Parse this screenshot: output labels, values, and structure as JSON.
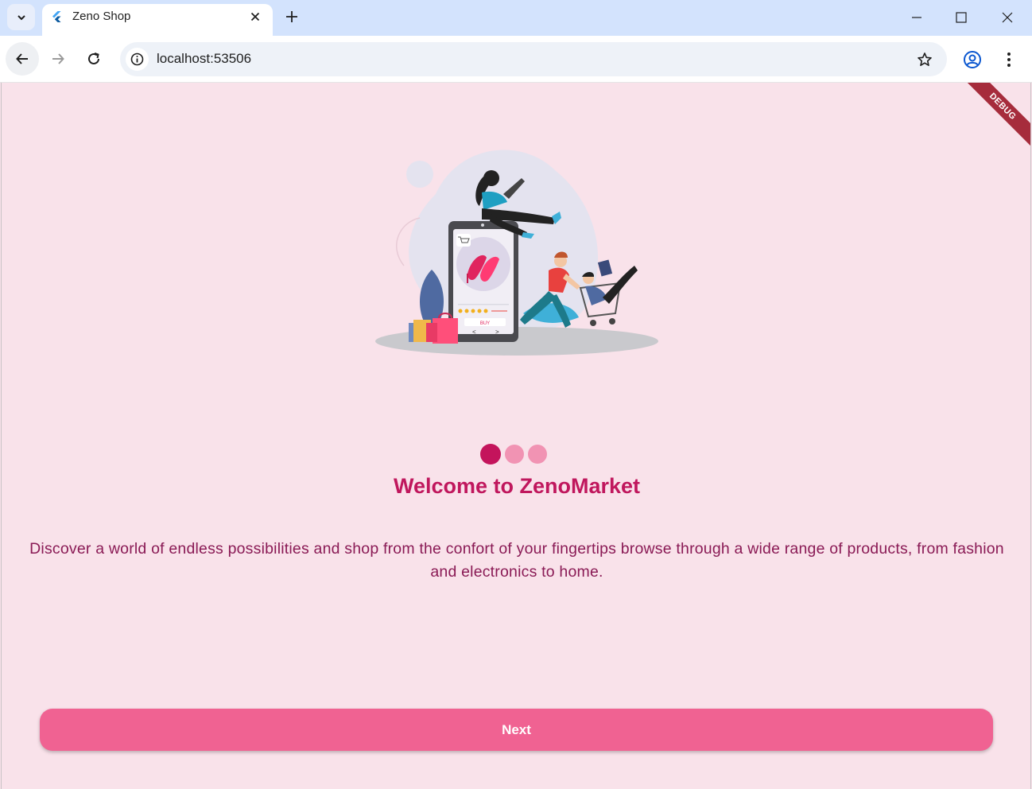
{
  "browser": {
    "tab_title": "Zeno Shop",
    "url": "localhost:53506"
  },
  "app": {
    "debug_banner": "DEBUG",
    "onboarding": {
      "page_count": 3,
      "active_index": 0,
      "title": "Welcome to ZenoMarket",
      "description": "Discover a world of endless possibilities and shop from the confort of your fingertips browse through a wide range of products, from fashion and electronics to home.",
      "next_label": "Next"
    },
    "phone_screen": {
      "buy_label": "BUY",
      "prev_label": "<",
      "next_label": ">"
    }
  },
  "colors": {
    "background": "#f9e2ea",
    "primary": "#c0175d",
    "button": "#f06292",
    "dot_active": "#c4145c",
    "dot_inactive": "#f193b3"
  }
}
